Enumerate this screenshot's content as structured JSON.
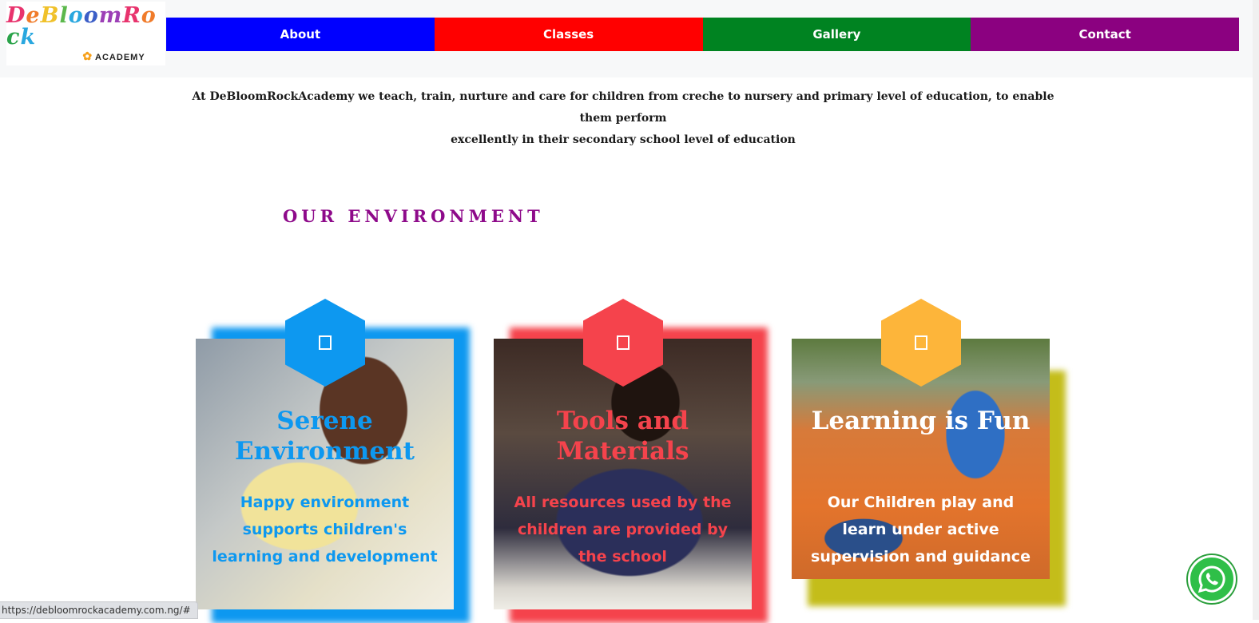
{
  "header": {
    "logo": {
      "main": "DeBloomRock",
      "sub": "ACADEMY"
    },
    "nav": [
      {
        "label": "About",
        "color": "#0000ff"
      },
      {
        "label": "Classes",
        "color": "#ff0000"
      },
      {
        "label": "Gallery",
        "color": "#008321"
      },
      {
        "label": "Contact",
        "color": "#8b0180"
      }
    ]
  },
  "intro": {
    "line1": "At DeBloomRockAcademy we teach, train, nurture and care for children from creche to nursery and primary level of education, to enable them perform",
    "line2": "excellently in their secondary school level of education"
  },
  "section": {
    "title": "OUR ENVIRONMENT"
  },
  "cards": [
    {
      "title": "Serene Environment",
      "text": "Happy environment supports children's learning and development",
      "accent": "#0d98f0",
      "icon": "leaf-icon"
    },
    {
      "title": "Tools and Materials",
      "text": "All resources used by the children are provided by the school",
      "accent": "#f5434c",
      "icon": "pencil-icon"
    },
    {
      "title": "Learning is Fun",
      "text": "Our Children play and learn under active supervision and guidance",
      "accent": "#fdb53a",
      "icon": "smile-icon"
    }
  ],
  "status_bar": {
    "url": "https://debloomrockacademy.com.ng/#"
  },
  "whatsapp": {
    "icon": "whatsapp-icon"
  }
}
